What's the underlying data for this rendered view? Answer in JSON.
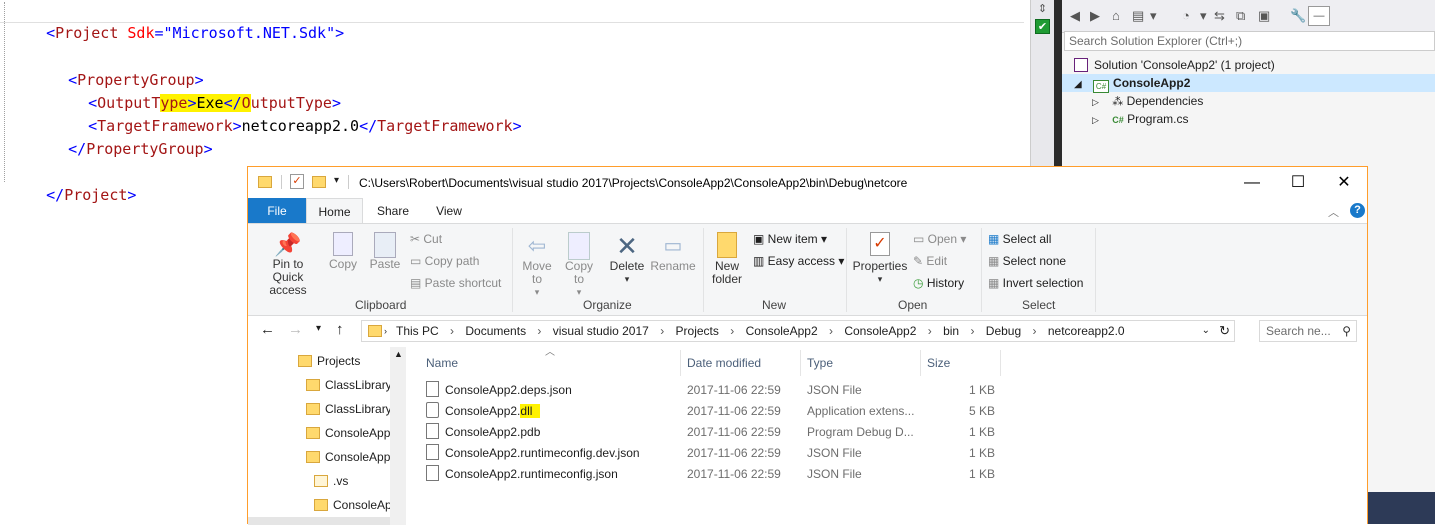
{
  "editor": {
    "line1": {
      "open": "<",
      "tag": "Project",
      "space": " ",
      "attr": "Sdk",
      "eq": "=",
      "val": "\"Microsoft.NET.Sdk\"",
      "close": ">"
    },
    "line3": {
      "open": "<",
      "tag": "PropertyGroup",
      "close": ">"
    },
    "line4": {
      "open": "<",
      "tag_a": "OutputT",
      "tag_b": "ype",
      "close_a": ">",
      "text": "Exe",
      "close_open": "</",
      "tag_c": "O",
      "tag_d": "utputType",
      "close": ">"
    },
    "line5": {
      "open": "<",
      "tag": "TargetFramework",
      "close": ">",
      "text": "netcoreapp2.0",
      "close_open": "</",
      "tag2": "TargetFramework",
      "close2": ">"
    },
    "line6": {
      "open": "</",
      "tag": "PropertyGroup",
      "close": ">"
    },
    "line8": {
      "open": "</",
      "tag": "Project",
      "close": ">"
    }
  },
  "solution_explorer": {
    "search_placeholder": "Search Solution Explorer (Ctrl+;)",
    "solution_label": "Solution 'ConsoleApp2' (1 project)",
    "project_label": "ConsoleApp2",
    "dependencies_label": "Dependencies",
    "program_label": "Program.cs",
    "csharp_badge": "C#",
    "csharp_small": "C#"
  },
  "explorer": {
    "title_path": "C:\\Users\\Robert\\Documents\\visual studio 2017\\Projects\\ConsoleApp2\\ConsoleApp2\\bin\\Debug\\netcore",
    "tabs": {
      "file": "File",
      "home": "Home",
      "share": "Share",
      "view": "View"
    },
    "ribbon": {
      "pin": "Pin to Quick access",
      "copy": "Copy",
      "paste": "Paste",
      "cut": "Cut",
      "copy_path": "Copy path",
      "paste_shortcut": "Paste shortcut",
      "clipboard": "Clipboard",
      "move_to": "Move to",
      "copy_to": "Copy to",
      "delete": "Delete",
      "rename": "Rename",
      "organize": "Organize",
      "new_folder": "New folder",
      "new_item": "New item",
      "easy_access": "Easy access",
      "new": "New",
      "properties": "Properties",
      "open": "Open",
      "edit": "Edit",
      "history": "History",
      "open_group": "Open",
      "select_all": "Select all",
      "select_none": "Select none",
      "invert_selection": "Invert selection",
      "select": "Select"
    },
    "breadcrumb": [
      "This PC",
      "Documents",
      "visual studio 2017",
      "Projects",
      "ConsoleApp2",
      "ConsoleApp2",
      "bin",
      "Debug",
      "netcoreapp2.0"
    ],
    "search_placeholder": "Search ne...",
    "nav": [
      "Projects",
      "ClassLibrary",
      "ClassLibrary",
      "ConsoleApp",
      "ConsoleApp",
      ".vs",
      "ConsoleAp"
    ],
    "columns": {
      "name": "Name",
      "date": "Date modified",
      "type": "Type",
      "size": "Size"
    },
    "files": [
      {
        "name": "ConsoleApp2.deps.json",
        "date": "2017-11-06 22:59",
        "type": "JSON File",
        "size": "1 KB"
      },
      {
        "name_a": "ConsoleApp2.",
        "name_b": "dll",
        "date": "2017-11-06 22:59",
        "type": "Application extens...",
        "size": "5 KB"
      },
      {
        "name": "ConsoleApp2.pdb",
        "date": "2017-11-06 22:59",
        "type": "Program Debug D...",
        "size": "1 KB"
      },
      {
        "name": "ConsoleApp2.runtimeconfig.dev.json",
        "date": "2017-11-06 22:59",
        "type": "JSON File",
        "size": "1 KB"
      },
      {
        "name": "ConsoleApp2.runtimeconfig.json",
        "date": "2017-11-06 22:59",
        "type": "JSON File",
        "size": "1 KB"
      }
    ]
  }
}
